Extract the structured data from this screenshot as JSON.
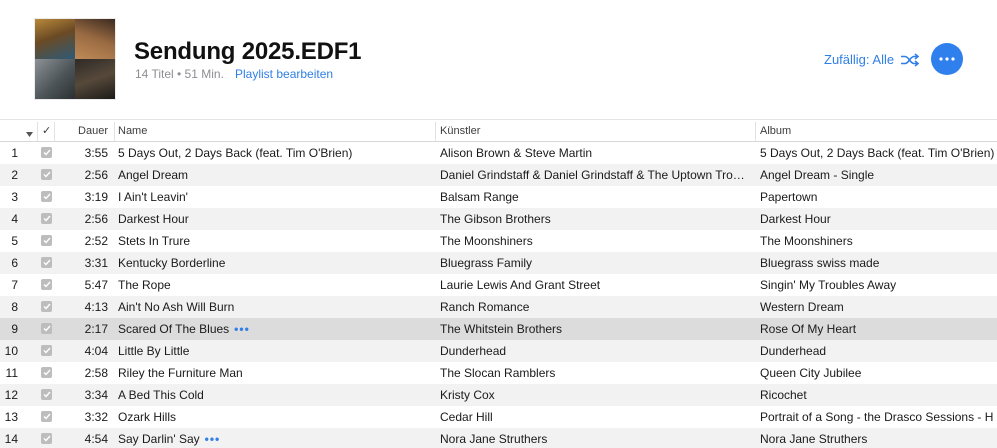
{
  "playlist": {
    "title": "Sendung 2025.EDF1",
    "meta": "14 Titel • 51 Min.",
    "edit_label": "Playlist bearbeiten",
    "shuffle_label": "Zufällig: Alle",
    "more_icon": "ellipsis-icon",
    "accent_color": "#2f7fe6"
  },
  "table": {
    "headers": {
      "check": "✓",
      "duration": "Dauer",
      "name": "Name",
      "artist": "Künstler",
      "album": "Album"
    },
    "rows": [
      {
        "num": "1",
        "duration": "3:55",
        "name": "5 Days Out, 2 Days Back (feat. Tim O'Brien)",
        "artist": "Alison Brown & Steve Martin",
        "album": "5 Days Out, 2 Days Back (feat. Tim O'Brien)",
        "more": ""
      },
      {
        "num": "2",
        "duration": "2:56",
        "name": "Angel Dream",
        "artist": "Daniel Grindstaff & Daniel Grindstaff & The Uptown Tro…",
        "album": "Angel Dream - Single",
        "more": ""
      },
      {
        "num": "3",
        "duration": "3:19",
        "name": "I Ain't Leavin'",
        "artist": "Balsam Range",
        "album": "Papertown",
        "more": ""
      },
      {
        "num": "4",
        "duration": "2:56",
        "name": "Darkest Hour",
        "artist": "The Gibson Brothers",
        "album": "Darkest Hour",
        "more": ""
      },
      {
        "num": "5",
        "duration": "2:52",
        "name": "Stets In Trure",
        "artist": "The Moonshiners",
        "album": "The Moonshiners",
        "more": ""
      },
      {
        "num": "6",
        "duration": "3:31",
        "name": "Kentucky Borderline",
        "artist": "Bluegrass Family",
        "album": "Bluegrass swiss made",
        "more": ""
      },
      {
        "num": "7",
        "duration": "5:47",
        "name": "The Rope",
        "artist": "Laurie Lewis And Grant Street",
        "album": "Singin' My Troubles Away",
        "more": ""
      },
      {
        "num": "8",
        "duration": "4:13",
        "name": "Ain't No Ash Will Burn",
        "artist": "Ranch Romance",
        "album": "Western Dream",
        "more": ""
      },
      {
        "num": "9",
        "duration": "2:17",
        "name": "Scared Of The Blues",
        "artist": "The Whitstein Brothers",
        "album": "Rose Of My Heart",
        "more": "•••"
      },
      {
        "num": "10",
        "duration": "4:04",
        "name": "Little By Little",
        "artist": "Dunderhead",
        "album": "Dunderhead",
        "more": ""
      },
      {
        "num": "11",
        "duration": "2:58",
        "name": "Riley the Furniture Man",
        "artist": "The Slocan Ramblers",
        "album": "Queen City Jubilee",
        "more": ""
      },
      {
        "num": "12",
        "duration": "3:34",
        "name": "A Bed This Cold",
        "artist": "Kristy Cox",
        "album": "Ricochet",
        "more": ""
      },
      {
        "num": "13",
        "duration": "3:32",
        "name": "Ozark Hills",
        "artist": "Cedar Hill",
        "album": "Portrait of a Song - the Drasco Sessions - H",
        "more": ""
      },
      {
        "num": "14",
        "duration": "4:54",
        "name": "Say Darlin' Say",
        "artist": "Nora Jane Struthers",
        "album": "Nora Jane Struthers",
        "more": "•••"
      }
    ]
  }
}
